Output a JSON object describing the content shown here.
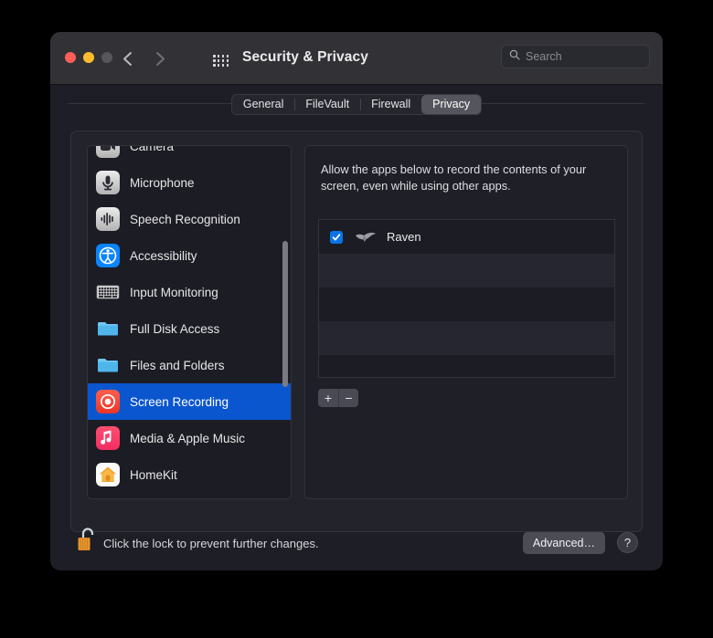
{
  "window": {
    "title": "Security & Privacy",
    "traffic_lights": [
      "close-red",
      "minimize-yellow",
      "zoom-gray"
    ],
    "nav": {
      "back": "back-chevron",
      "forward": "forward-chevron"
    },
    "grid_button": "show-all-grid-icon"
  },
  "search": {
    "placeholder": "Search",
    "value": "",
    "icon": "search-icon"
  },
  "tabs": [
    {
      "label": "General",
      "active": false
    },
    {
      "label": "FileVault",
      "active": false
    },
    {
      "label": "Firewall",
      "active": false
    },
    {
      "label": "Privacy",
      "active": true
    }
  ],
  "sidebar": {
    "items": [
      {
        "label": "Camera",
        "icon": "camera-icon",
        "selected": false
      },
      {
        "label": "Microphone",
        "icon": "microphone-icon",
        "selected": false
      },
      {
        "label": "Speech Recognition",
        "icon": "waveform-icon",
        "selected": false
      },
      {
        "label": "Accessibility",
        "icon": "accessibility-icon",
        "selected": false
      },
      {
        "label": "Input Monitoring",
        "icon": "keyboard-icon",
        "selected": false
      },
      {
        "label": "Full Disk Access",
        "icon": "folder-icon",
        "selected": false
      },
      {
        "label": "Files and Folders",
        "icon": "folder-icon",
        "selected": false
      },
      {
        "label": "Screen Recording",
        "icon": "screen-recording-icon",
        "selected": true
      },
      {
        "label": "Media & Apple Music",
        "icon": "music-note-icon",
        "selected": false
      },
      {
        "label": "HomeKit",
        "icon": "homekit-house-icon",
        "selected": false
      }
    ],
    "selected_index": 7
  },
  "detail": {
    "description": "Allow the apps below to record the contents of your screen, even while using other apps.",
    "apps": [
      {
        "name": "Raven",
        "checked": true,
        "icon": "raven-bird-icon"
      }
    ],
    "empty_rows": 4,
    "add_button": "+",
    "remove_button": "−"
  },
  "bottom": {
    "lock_icon": "unlocked-padlock-icon",
    "lock_text": "Click the lock to prevent further changes.",
    "advanced_label": "Advanced…",
    "help_label": "?"
  },
  "colors": {
    "window_bg": "#1e1e26",
    "titlebar_bg": "#323236",
    "selection_blue": "#0a56cf",
    "checkbox_blue": "#0a74e8",
    "accent_red": "#f23b2c",
    "lock_orange": "#e8962f"
  }
}
